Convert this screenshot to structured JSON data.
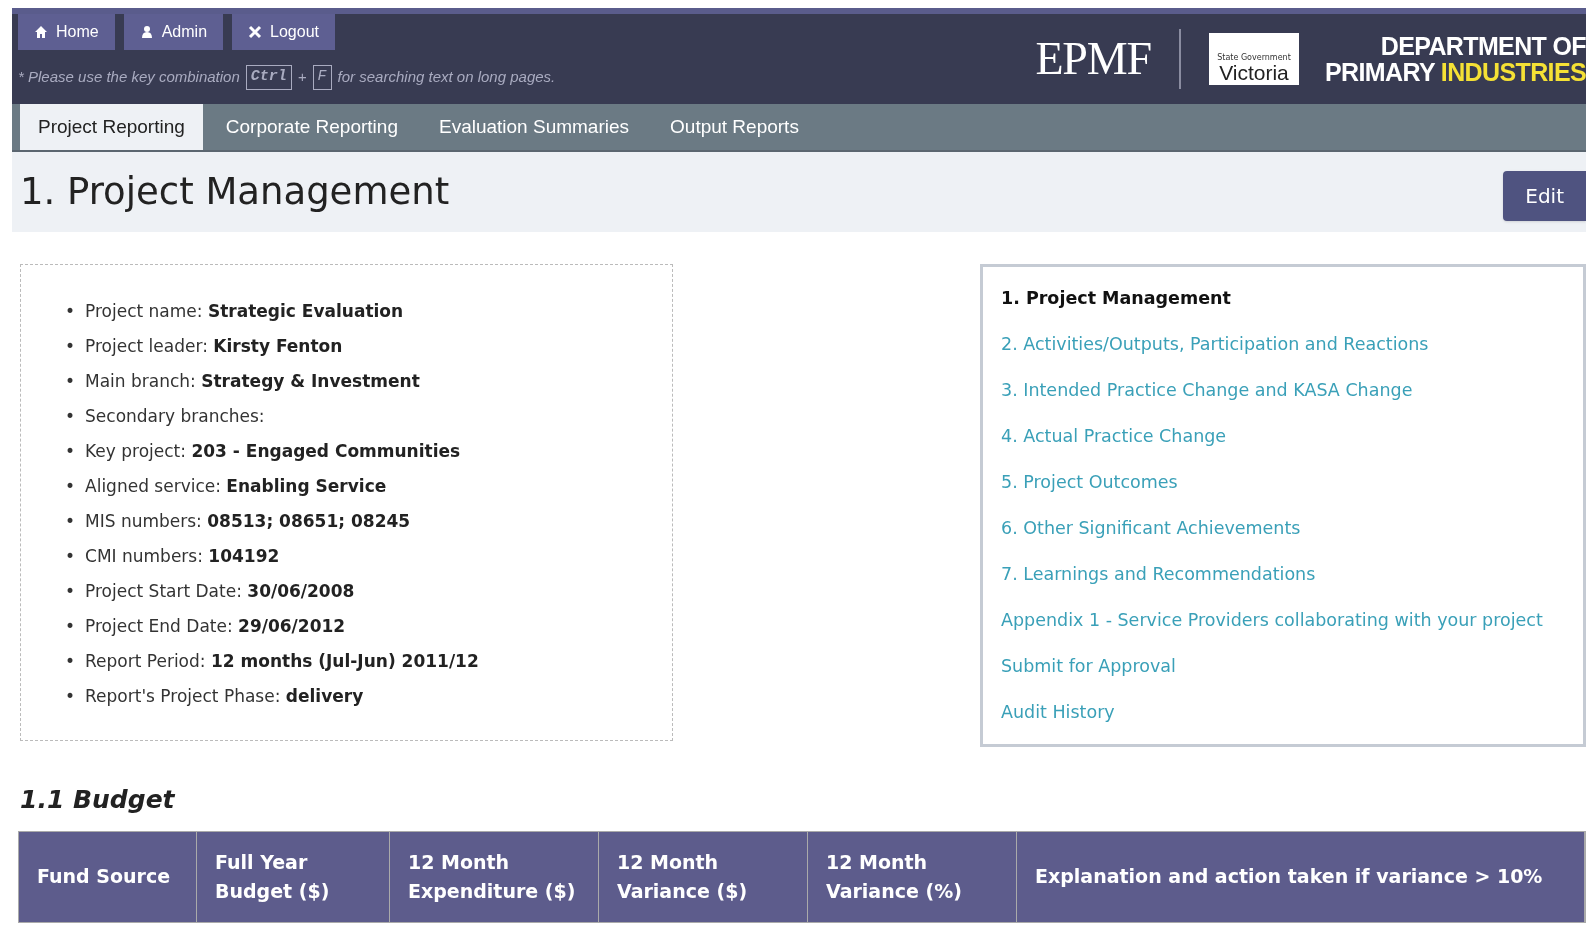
{
  "header": {
    "nav_buttons": [
      {
        "kind": "home",
        "label": "Home"
      },
      {
        "kind": "user",
        "label": "Admin"
      },
      {
        "kind": "close",
        "label": "Logout"
      }
    ],
    "hint": {
      "before": "* Please use the key combination",
      "key_1": "Ctrl",
      "plus": "+",
      "key_2": "F",
      "after": "for searching text on long pages."
    },
    "logo": {
      "app": "EPMF",
      "gov_small": "State Government",
      "gov": "Victoria",
      "dept_line_1": "DEPARTMENT OF",
      "dept_line_2a": "PRIMARY",
      "dept_line_2b": "INDUSTRIES"
    }
  },
  "tabs": [
    {
      "label": "Project Reporting",
      "selected": true
    },
    {
      "label": "Corporate Reporting",
      "selected": false
    },
    {
      "label": "Evaluation Summaries",
      "selected": false
    },
    {
      "label": "Output Reports",
      "selected": false
    }
  ],
  "page_title": "1. Project Management",
  "edit_button": "Edit",
  "details": [
    {
      "bullet": "•",
      "label": "Project name:",
      "value": "Strategic Evaluation"
    },
    {
      "bullet": "•",
      "label": "Project leader:",
      "value": "Kirsty Fenton"
    },
    {
      "bullet": "•",
      "label": "Main branch:",
      "value": "Strategy & Investment"
    },
    {
      "bullet": "•",
      "label": "Secondary branches:"
    },
    {
      "bullet": "•",
      "label": "Key project:",
      "value": "203 - Engaged Communities"
    },
    {
      "bullet": "•",
      "label": "Aligned service:",
      "value": "Enabling Service"
    },
    {
      "bullet": "•",
      "label": "MIS numbers:",
      "value": "08513; 08651; 08245"
    },
    {
      "bullet": "•",
      "label": "CMI numbers:",
      "value": "104192"
    },
    {
      "bullet": "•",
      "label": "Project Start Date:",
      "value": "30/06/2008"
    },
    {
      "bullet": "•",
      "label": "Project End Date:",
      "value": "29/06/2012"
    },
    {
      "bullet": "•",
      "label": "Report Period:",
      "value": "12 months (Jul-Jun) 2011/12"
    },
    {
      "bullet": "•",
      "label": "Report's Project Phase:",
      "value": "delivery"
    }
  ],
  "toc": [
    {
      "label": "1. Project Management",
      "selected": true
    },
    {
      "label": "2. Activities/Outputs, Participation and Reactions",
      "selected": false
    },
    {
      "label": "3. Intended Practice Change and KASA Change",
      "selected": false
    },
    {
      "label": "4. Actual Practice Change",
      "selected": false
    },
    {
      "label": "5. Project Outcomes",
      "selected": false
    },
    {
      "label": "6. Other Significant Achievements",
      "selected": false
    },
    {
      "label": "7. Learnings and Recommendations",
      "selected": false
    },
    {
      "label": "Appendix 1 - Service Providers collaborating with your project",
      "selected": false
    },
    {
      "label": "Submit for Approval",
      "selected": false
    },
    {
      "label": "Audit History",
      "selected": false
    }
  ],
  "budget": {
    "title": "1.1 Budget",
    "columns": [
      [
        "Fund Source"
      ],
      [
        "Full Year",
        "Budget ($)"
      ],
      [
        "12 Month",
        "Expenditure ($)"
      ],
      [
        "12 Month",
        "Variance ($)"
      ],
      [
        "12 Month",
        "Variance (%)"
      ],
      [
        "Explanation and action taken if variance > 10%"
      ]
    ]
  }
}
